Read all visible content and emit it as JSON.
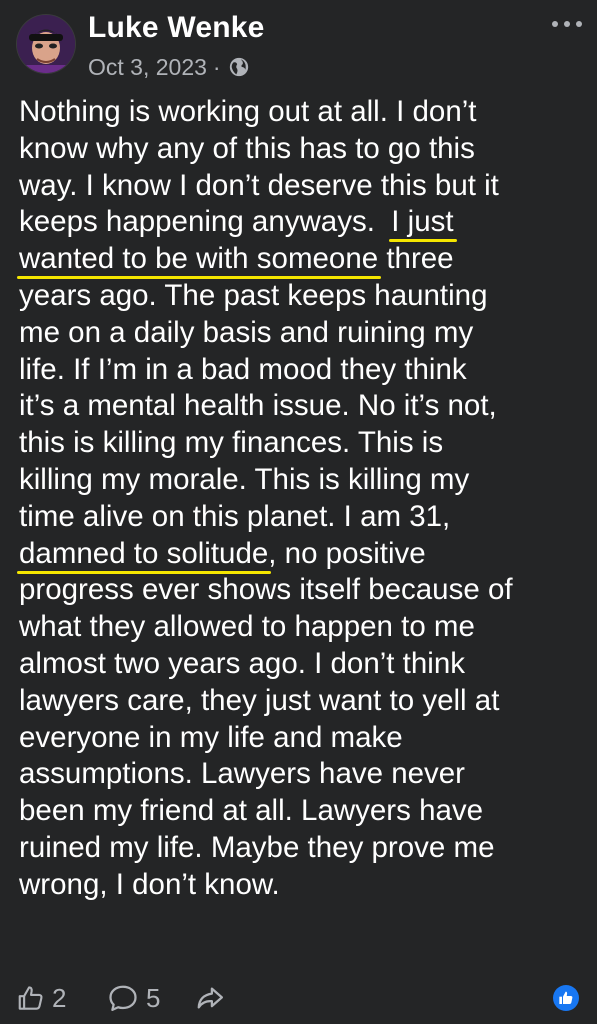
{
  "post": {
    "author": "Luke Wenke",
    "date": "Oct 3, 2023",
    "separator": "·",
    "audience_icon": "globe-icon",
    "more_icon": "more-options-icon",
    "lines": [
      [
        "Nothing is working out at all.  I don’t"
      ],
      [
        "know why any of this has to go this"
      ],
      [
        "way.  I know I don’t deserve this but it"
      ],
      [
        "keeps happening anyways.  ",
        "I just"
      ],
      [
        "wanted to be with someone",
        " three"
      ],
      [
        "years ago.  The past keeps haunting"
      ],
      [
        "me on a daily basis and ruining my"
      ],
      [
        "life.  If I’m in a bad mood they think"
      ],
      [
        "it’s a mental health issue.  No it’s not,"
      ],
      [
        "this is killing my finances.  This is"
      ],
      [
        "killing my morale.  This is killing my"
      ],
      [
        "time alive on this planet.  I am 31,"
      ],
      [
        "damned to solitude",
        ", no positive"
      ],
      [
        "progress ever shows itself because of"
      ],
      [
        "what they allowed to happen to me"
      ],
      [
        "almost two years ago.  I don’t think"
      ],
      [
        "lawyers care, they just want to yell at"
      ],
      [
        "everyone in my life and make"
      ],
      [
        "assumptions.  Lawyers have never"
      ],
      [
        "been my friend at all.  Lawyers have"
      ],
      [
        "ruined my life.  Maybe they prove me"
      ],
      [
        "wrong, I don’t know."
      ]
    ],
    "highlight_color": "#f5e600"
  },
  "footer": {
    "likes": "2",
    "comments": "5",
    "like_icon": "thumbs-up-icon",
    "comment_icon": "comment-icon",
    "share_icon": "share-icon",
    "reaction_icon": "like-reaction-icon",
    "reaction_color": "#1877f2"
  },
  "theme": {
    "background": "#242526",
    "text": "#ffffff",
    "secondary_text": "#b0b3b8"
  }
}
